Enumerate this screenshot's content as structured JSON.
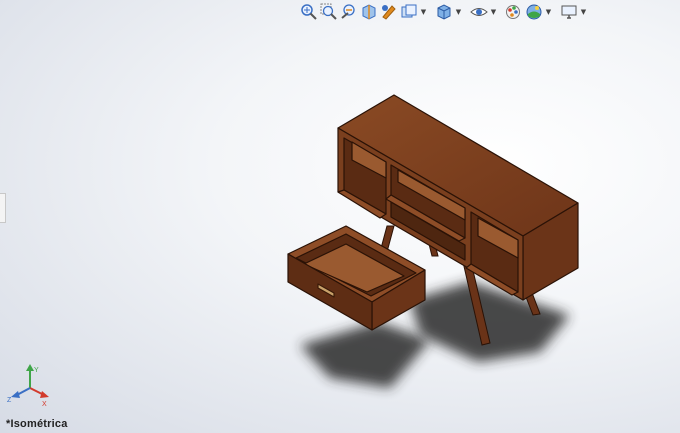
{
  "toolbar": {
    "items": [
      {
        "name": "zoom-to-fit-icon"
      },
      {
        "name": "zoom-to-area-icon"
      },
      {
        "name": "previous-view-icon"
      },
      {
        "name": "section-view-icon"
      },
      {
        "name": "dynamic-annotation-views-icon"
      },
      {
        "name": "view-orientation-icon"
      },
      {
        "name": "display-style-icon"
      },
      {
        "name": "hide-show-items-icon"
      },
      {
        "name": "edit-appearance-icon"
      },
      {
        "name": "apply-scene-icon"
      },
      {
        "name": "view-settings-icon"
      }
    ],
    "colors": {
      "blue": "#3a6fc4",
      "orange": "#e08a1e",
      "green": "#3fa548",
      "red": "#d23a2c"
    }
  },
  "viewport": {
    "view_name": "*Isométrica",
    "background_colors": [
      "#ffffff",
      "#d6dbe5"
    ]
  },
  "model": {
    "wood_color": "#7a3f1e",
    "wood_light": "#8e4d27",
    "wood_dark": "#4e2610",
    "shadow_color": "#2a2a2a"
  },
  "triad": {
    "x_label": "X",
    "y_label": "Y",
    "z_label": "Z",
    "x_color": "#d23a2c",
    "y_color": "#3fa548",
    "z_color": "#3a6fc4"
  }
}
